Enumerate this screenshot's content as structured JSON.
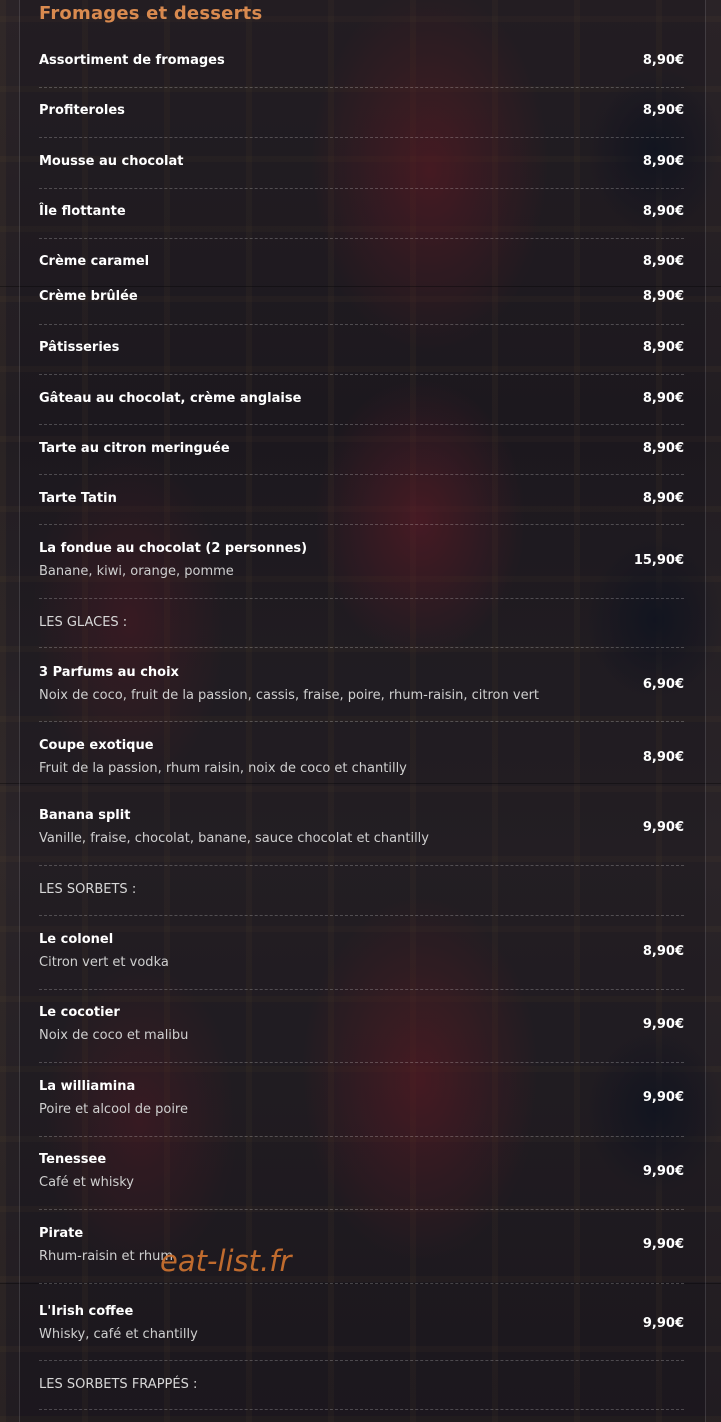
{
  "section_title": "Fromages et desserts",
  "items": [
    {
      "name": "Assortiment de fromages",
      "price": "8,90€"
    },
    {
      "name": "Profiteroles",
      "price": "8,90€"
    },
    {
      "name": "Mousse au chocolat",
      "price": "8,90€"
    },
    {
      "name": "Île flottante",
      "price": "8,90€"
    },
    {
      "name": "Crème caramel",
      "price": "8,90€"
    },
    {
      "name": "Crème brûlée",
      "price": "8,90€"
    },
    {
      "name": "Pâtisseries",
      "price": "8,90€"
    },
    {
      "name": "Gâteau au chocolat, crème anglaise",
      "price": "8,90€"
    },
    {
      "name": "Tarte au citron meringuée",
      "price": "8,90€"
    },
    {
      "name": "Tarte Tatin",
      "price": "8,90€"
    },
    {
      "name": "La fondue au chocolat (2 personnes)",
      "desc": "Banane, kiwi, orange, pomme",
      "price": "15,90€"
    }
  ],
  "glaces": {
    "label": "LES GLACES :",
    "items": [
      {
        "name": "3 Parfums au choix",
        "desc": "Noix de coco, fruit de la passion, cassis, fraise, poire, rhum-raisin, citron vert",
        "price": "6,90€"
      },
      {
        "name": "Coupe exotique",
        "desc": "Fruit de la passion, rhum raisin, noix de coco et chantilly",
        "price": "8,90€"
      },
      {
        "name": "Banana split",
        "desc": "Vanille, fraise, chocolat, banane, sauce chocolat et chantilly",
        "price": "9,90€"
      }
    ]
  },
  "sorbets": {
    "label": "LES SORBETS :",
    "items": [
      {
        "name": "Le colonel",
        "desc": "Citron vert et vodka",
        "price": "8,90€"
      },
      {
        "name": "Le cocotier",
        "desc": "Noix de coco et malibu",
        "price": "9,90€"
      },
      {
        "name": "La williamina",
        "desc": "Poire et alcool de poire",
        "price": "9,90€"
      },
      {
        "name": "Tenessee",
        "desc": "Café et whisky",
        "price": "9,90€"
      },
      {
        "name": "Pirate",
        "desc": "Rhum-raisin et rhum",
        "price": "9,90€"
      },
      {
        "name": "L'Irish coffee",
        "desc": "Whisky, café et chantilly",
        "price": "9,90€"
      }
    ]
  },
  "sorbets_frappes": {
    "label": "LES SORBETS FRAPPÉS :"
  },
  "watermark": "eat-list.fr"
}
